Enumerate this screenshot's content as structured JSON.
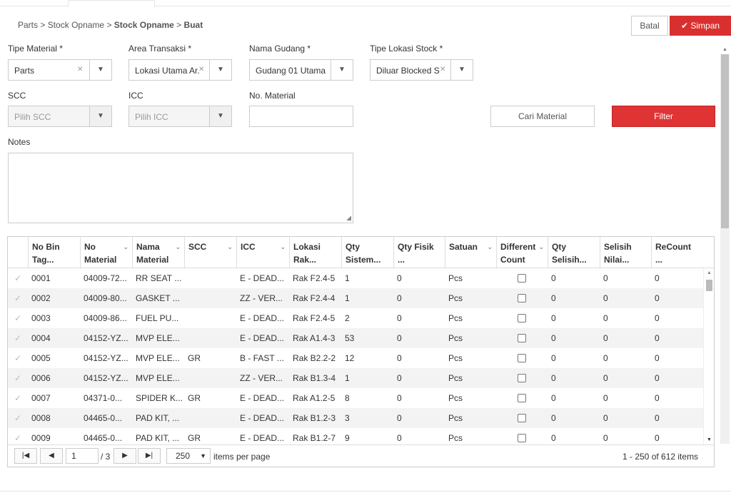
{
  "breadcrumb": {
    "parts": "Parts",
    "sep": ">",
    "stock": "Stock Opname",
    "stock_bold": "Stock Opname",
    "buat": "Buat"
  },
  "actions": {
    "batal": "Batal",
    "simpan": "Simpan",
    "accent": "#d9302f"
  },
  "form": {
    "tipe_material": {
      "label": "Tipe Material *",
      "value": "Parts"
    },
    "area_transaksi": {
      "label": "Area Transaksi *",
      "value": "Lokasi Utama Ar."
    },
    "nama_gudang": {
      "label": "Nama Gudang *",
      "value": "Gudang 01 Utama"
    },
    "tipe_lokasi": {
      "label": "Tipe Lokasi Stock *",
      "value": "Diluar Blocked S."
    },
    "scc": {
      "label": "SCC",
      "placeholder": "Pilih SCC"
    },
    "icc": {
      "label": "ICC",
      "placeholder": "Pilih ICC"
    },
    "no_material": {
      "label": "No. Material",
      "value": ""
    },
    "cari_material": "Cari Material",
    "filter": "Filter",
    "notes": {
      "label": "Notes",
      "value": ""
    }
  },
  "grid": {
    "columns": [
      {
        "label": "No Bin Tag..."
      },
      {
        "label": "No Material"
      },
      {
        "label": "Nama Material"
      },
      {
        "label": "SCC"
      },
      {
        "label": "ICC"
      },
      {
        "label": "Lokasi Rak..."
      },
      {
        "label": "Qty Sistem..."
      },
      {
        "label": "Qty Fisik ..."
      },
      {
        "label": "Satuan"
      },
      {
        "label": "Different Count"
      },
      {
        "label": "Qty Selisih..."
      },
      {
        "label": "Selisih Nilai..."
      },
      {
        "label": "ReCount ..."
      }
    ],
    "rows": [
      {
        "bin": "0001",
        "no": "04009-72...",
        "nama": "RR SEAT ...",
        "scc": "",
        "icc": "E - DEAD...",
        "rak": "Rak F2.4-5",
        "sis": "1",
        "fis": "0",
        "sat": "Pcs",
        "diff": false,
        "sel": "0",
        "nil": "0",
        "rec": "0"
      },
      {
        "bin": "0002",
        "no": "04009-80...",
        "nama": "GASKET ...",
        "scc": "",
        "icc": "ZZ - VER...",
        "rak": "Rak F2.4-4",
        "sis": "1",
        "fis": "0",
        "sat": "Pcs",
        "diff": false,
        "sel": "0",
        "nil": "0",
        "rec": "0"
      },
      {
        "bin": "0003",
        "no": "04009-86...",
        "nama": "FUEL PU...",
        "scc": "",
        "icc": "E - DEAD...",
        "rak": "Rak F2.4-5",
        "sis": "2",
        "fis": "0",
        "sat": "Pcs",
        "diff": false,
        "sel": "0",
        "nil": "0",
        "rec": "0"
      },
      {
        "bin": "0004",
        "no": "04152-YZ...",
        "nama": "MVP ELE...",
        "scc": "",
        "icc": "E - DEAD...",
        "rak": "Rak A1.4-3",
        "sis": "53",
        "fis": "0",
        "sat": "Pcs",
        "diff": false,
        "sel": "0",
        "nil": "0",
        "rec": "0"
      },
      {
        "bin": "0005",
        "no": "04152-YZ...",
        "nama": "MVP ELE...",
        "scc": "GR",
        "icc": "B - FAST ...",
        "rak": "Rak B2.2-2",
        "sis": "12",
        "fis": "0",
        "sat": "Pcs",
        "diff": false,
        "sel": "0",
        "nil": "0",
        "rec": "0"
      },
      {
        "bin": "0006",
        "no": "04152-YZ...",
        "nama": "MVP ELE...",
        "scc": "",
        "icc": "ZZ - VER...",
        "rak": "Rak B1.3-4",
        "sis": "1",
        "fis": "0",
        "sat": "Pcs",
        "diff": false,
        "sel": "0",
        "nil": "0",
        "rec": "0"
      },
      {
        "bin": "0007",
        "no": "04371-0...",
        "nama": "SPIDER K...",
        "scc": "GR",
        "icc": "E - DEAD...",
        "rak": "Rak A1.2-5",
        "sis": "8",
        "fis": "0",
        "sat": "Pcs",
        "diff": false,
        "sel": "0",
        "nil": "0",
        "rec": "0"
      },
      {
        "bin": "0008",
        "no": "04465-0...",
        "nama": "PAD KIT, ...",
        "scc": "",
        "icc": "E - DEAD...",
        "rak": "Rak B1.2-3",
        "sis": "3",
        "fis": "0",
        "sat": "Pcs",
        "diff": false,
        "sel": "0",
        "nil": "0",
        "rec": "0"
      },
      {
        "bin": "0009",
        "no": "04465-0...",
        "nama": "PAD KIT, ...",
        "scc": "GR",
        "icc": "E - DEAD...",
        "rak": "Rak B1.2-7",
        "sis": "9",
        "fis": "0",
        "sat": "Pcs",
        "diff": false,
        "sel": "0",
        "nil": "0",
        "rec": "0"
      }
    ]
  },
  "pager": {
    "page": "1",
    "of_pages": "/ 3",
    "page_size": "250",
    "per_page": "items per page",
    "summary": "1 - 250 of 612 items"
  }
}
